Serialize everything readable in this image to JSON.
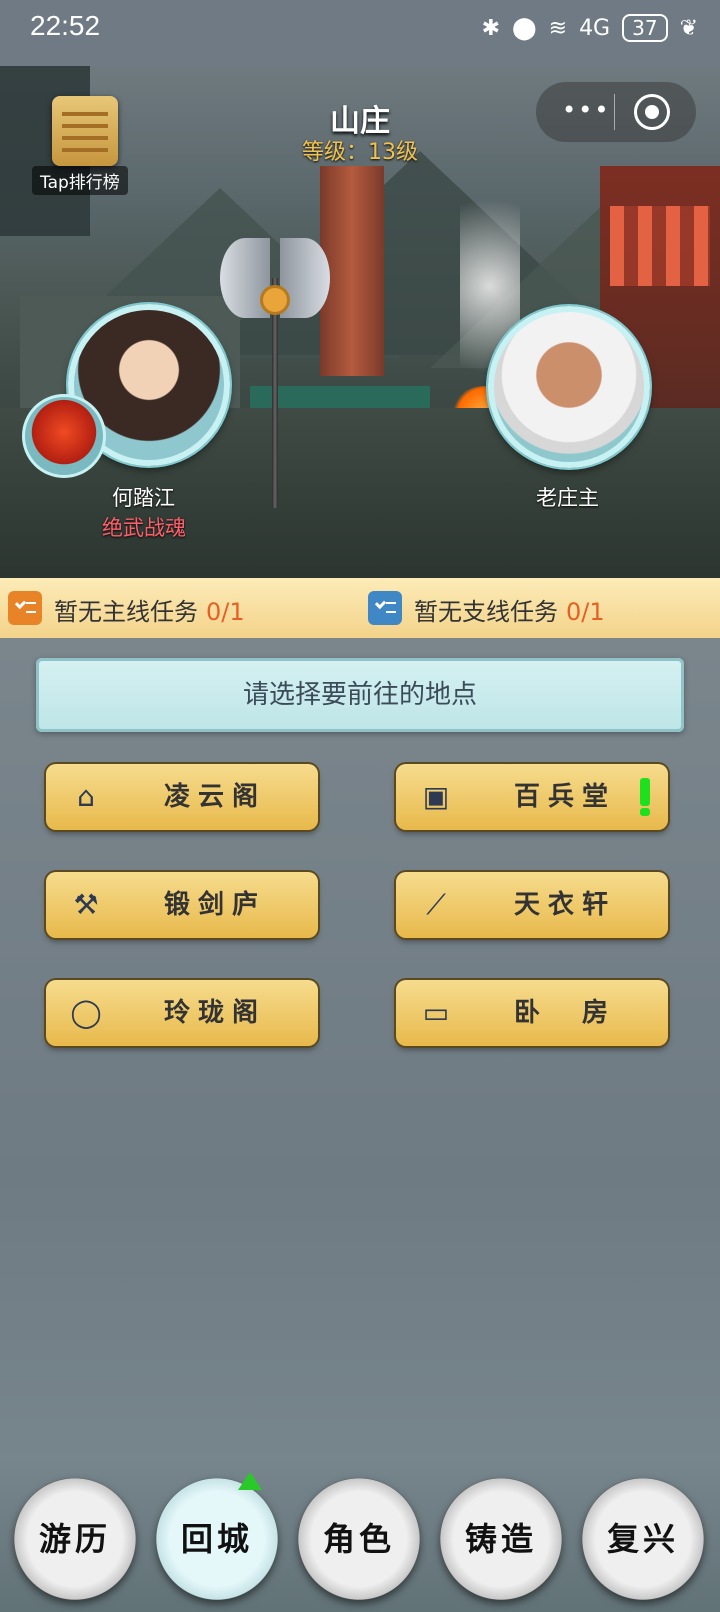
{
  "status_bar": {
    "time": "22:52",
    "icons": [
      "bluetooth-icon",
      "location-icon",
      "wifi-icon",
      "signal-4g-icon",
      "battery-icon",
      "leaf-icon"
    ],
    "battery": "37",
    "signal_label": "4G"
  },
  "header": {
    "title": "山庄",
    "level": "等级：13级",
    "leaderboard": "Tap排行榜"
  },
  "characters": {
    "hero_name": "何踏江",
    "hero_title": "绝武战魂",
    "elder_name": "老庄主"
  },
  "quests": {
    "main_text": "暂无主线任务",
    "main_count": "0/1",
    "side_text": "暂无支线任务",
    "side_count": "0/1"
  },
  "locations": {
    "prompt": "请选择要前往的地点",
    "items": [
      {
        "label": "凌云阁",
        "icon": "home-icon"
      },
      {
        "label": "百兵堂",
        "icon": "clipboard-icon",
        "alert": true
      },
      {
        "label": "锻剑庐",
        "icon": "anvil-icon"
      },
      {
        "label": "天衣轩",
        "icon": "needle-icon"
      },
      {
        "label": "玲珑阁",
        "icon": "ring-icon"
      },
      {
        "label": "卧　房",
        "icon": "bed-icon"
      }
    ]
  },
  "nav": {
    "items": [
      {
        "label": "游历"
      },
      {
        "label": "回城",
        "active": true,
        "badge": "up-arrow-icon"
      },
      {
        "label": "角色"
      },
      {
        "label": "铸造"
      },
      {
        "label": "复兴"
      }
    ]
  },
  "colors": {
    "quest_orange": "#e88427",
    "quest_blue": "#3f88c5",
    "count_red": "#e66026",
    "level_gold": "#f1c24d",
    "alert_green": "#1fe01f"
  }
}
